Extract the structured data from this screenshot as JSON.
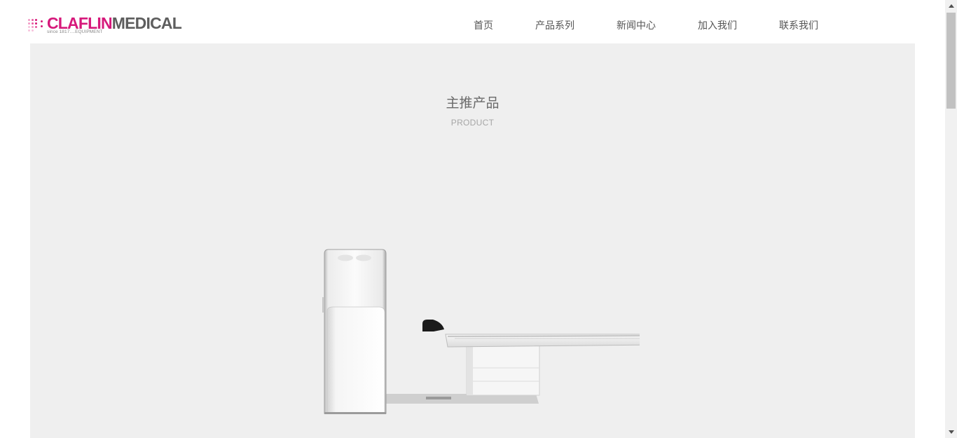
{
  "header": {
    "logo": {
      "brand_primary": "CLAFLIN",
      "brand_secondary": "MEDICAL",
      "tagline": "since 1817....EQUIPMENT",
      "brand_color": "#d6197b",
      "secondary_color": "#5e5e5e"
    },
    "nav": [
      {
        "label": "首页"
      },
      {
        "label": "产品系列"
      },
      {
        "label": "新闻中心"
      },
      {
        "label": "加入我们"
      },
      {
        "label": "联系我们"
      }
    ]
  },
  "main": {
    "section_title": "主推产品",
    "section_subtitle": "PRODUCT",
    "background_color": "#efefef",
    "product_image": "ct-scanner-image"
  },
  "scrollbar": {
    "up_icon": "scroll-up-arrow-icon",
    "down_icon": "scroll-down-arrow-icon"
  }
}
